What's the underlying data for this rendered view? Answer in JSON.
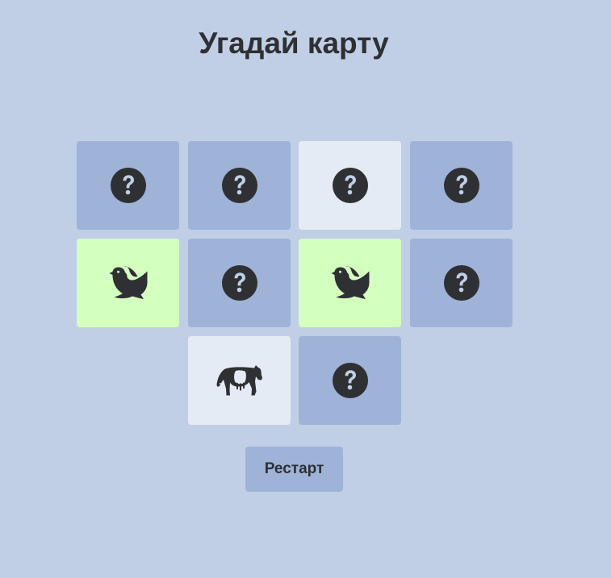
{
  "title": "Угадай карту",
  "restart_label": "Рестарт",
  "colors": {
    "background": "#c0cfe6",
    "card_hidden": "#9eb3d7",
    "card_selected": "#e5ebf5",
    "card_matched": "#d3ffbf",
    "icon": "#2f3033"
  },
  "cards": [
    {
      "state": "hidden",
      "icon": "question-icon"
    },
    {
      "state": "hidden",
      "icon": "question-icon"
    },
    {
      "state": "selected",
      "icon": "question-icon"
    },
    {
      "state": "hidden",
      "icon": "question-icon"
    },
    {
      "state": "matched",
      "icon": "dove-icon"
    },
    {
      "state": "hidden",
      "icon": "question-icon"
    },
    {
      "state": "matched",
      "icon": "dove-icon"
    },
    {
      "state": "hidden",
      "icon": "question-icon"
    },
    {
      "state": "selected",
      "icon": "cow-icon"
    },
    {
      "state": "hidden",
      "icon": "question-icon"
    }
  ]
}
